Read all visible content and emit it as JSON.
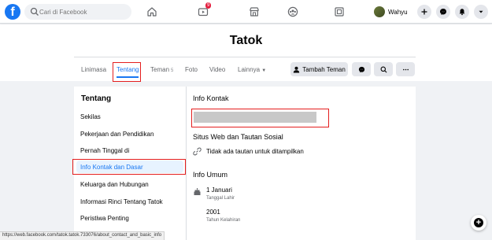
{
  "topnav": {
    "logo_text": "f",
    "search_placeholder": "Cari di Facebook",
    "watch_badge": "9",
    "user_name": "Wahyu",
    "icons": [
      "home-icon",
      "watch-icon",
      "marketplace-icon",
      "groups-icon",
      "gaming-icon",
      "plus-icon",
      "messenger-icon",
      "bell-icon",
      "caret-down-icon"
    ]
  },
  "profile": {
    "name": "Tatok",
    "tabs": {
      "timeline": "Linimasa",
      "about": "Tentang",
      "friends": "Teman",
      "friends_count": "5",
      "photos": "Foto",
      "video": "Video",
      "more": "Lainnya"
    },
    "add_friend": "Tambah Teman"
  },
  "sidebar": {
    "title": "Tentang",
    "items": [
      {
        "label": "Sekilas"
      },
      {
        "label": "Pekerjaan dan Pendidikan"
      },
      {
        "label": "Pernah Tinggal di"
      },
      {
        "label": "Info Kontak dan Dasar"
      },
      {
        "label": "Keluarga dan Hubungan"
      },
      {
        "label": "Informasi Rinci Tentang Tatok"
      },
      {
        "label": "Peristiwa Penting"
      }
    ],
    "active_index": 3
  },
  "content": {
    "contact_title": "Info Kontak",
    "web_title": "Situs Web dan Tautan Sosial",
    "web_empty": "Tidak ada tautan untuk ditampilkan",
    "basic_title": "Info Umum",
    "birth_date": "1 Januari",
    "birth_date_label": "Tanggal Lahir",
    "birth_year": "2001",
    "birth_year_label": "Tahun Kelahiran"
  },
  "statusbar": "https://web.facebook.com/tatok.tatok.733076/about_contact_and_basic_info",
  "colors": {
    "accent": "#1877f2",
    "highlight": "#e41e1e"
  }
}
